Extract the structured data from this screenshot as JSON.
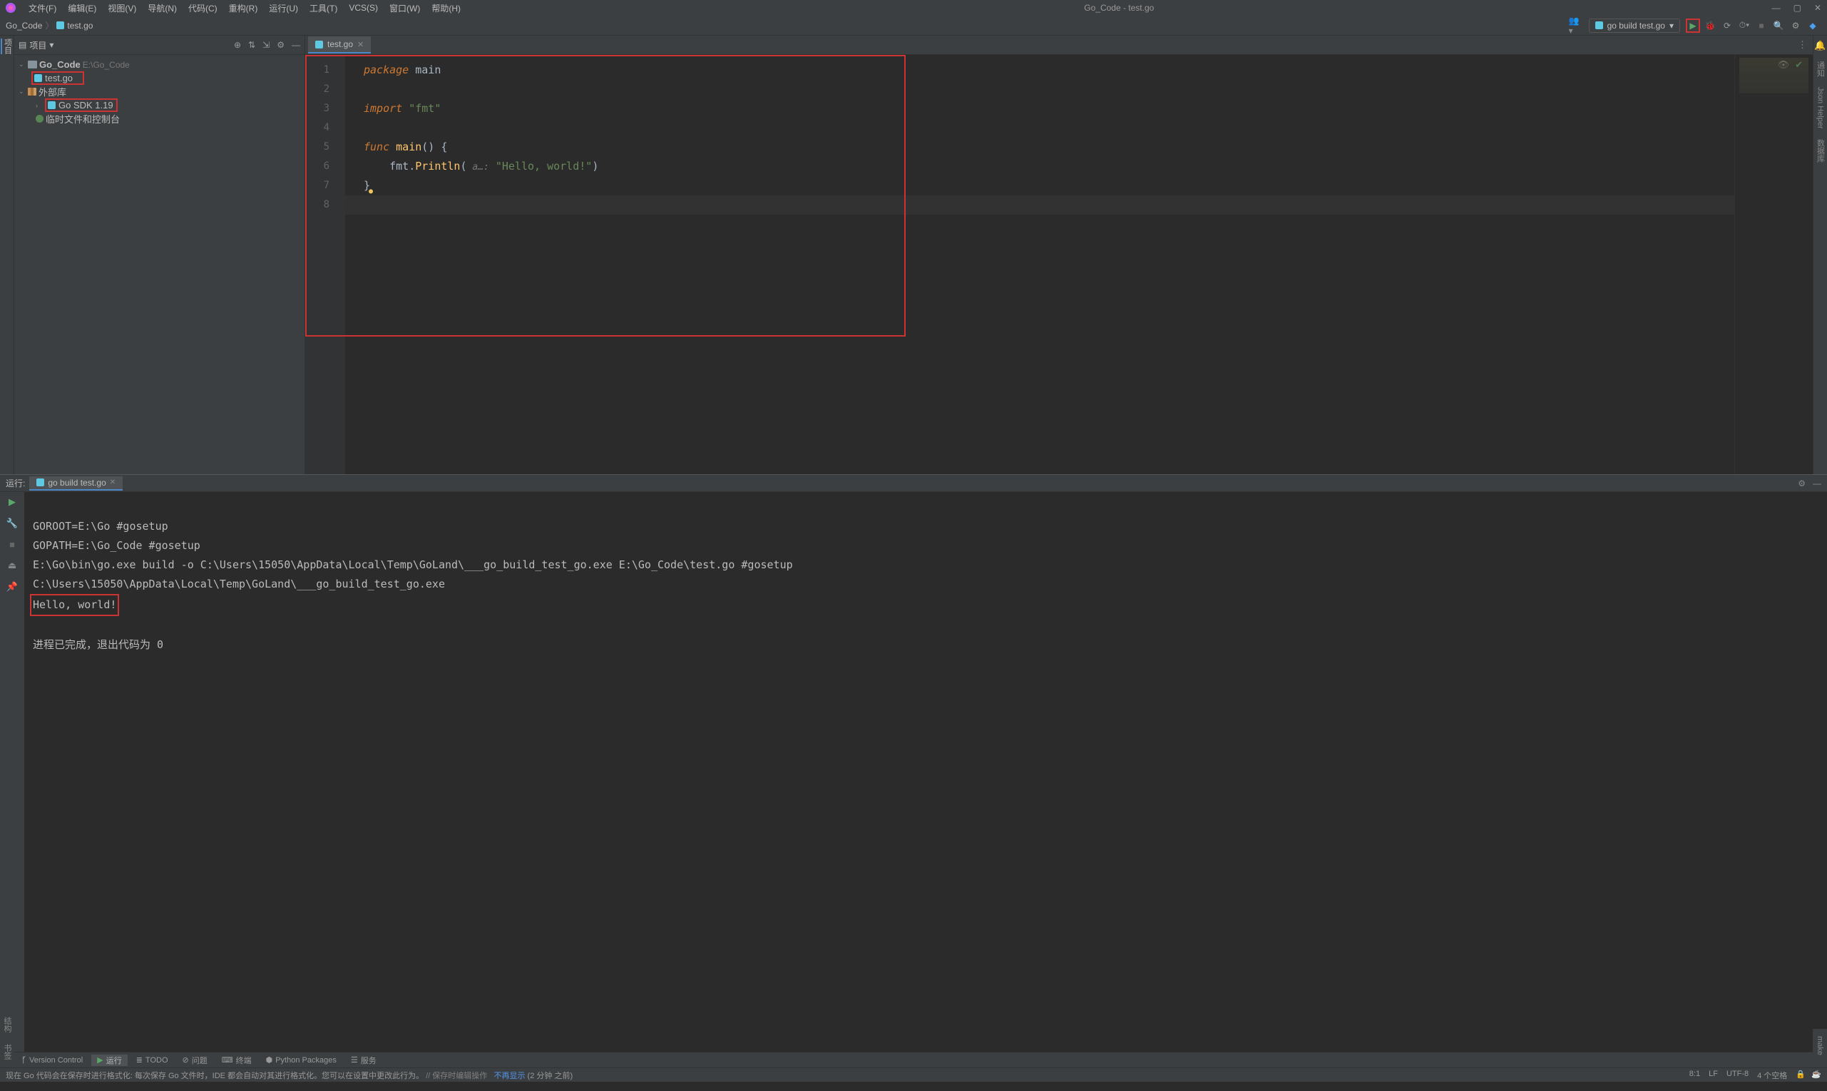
{
  "titlebar": {
    "menus": [
      "文件(F)",
      "编辑(E)",
      "视图(V)",
      "导航(N)",
      "代码(C)",
      "重构(R)",
      "运行(U)",
      "工具(T)",
      "VCS(S)",
      "窗口(W)",
      "帮助(H)"
    ],
    "title": "Go_Code - test.go"
  },
  "navbar": {
    "crumb_root": "Go_Code",
    "crumb_file": "test.go",
    "run_config": "go build test.go"
  },
  "sidebar": {
    "header_label": "项目",
    "root": {
      "name": "Go_Code",
      "path": "E:\\Go_Code"
    },
    "file": "test.go",
    "external_libs": "外部库",
    "go_sdk": "Go SDK 1.19",
    "scratches": "临时文件和控制台"
  },
  "editor": {
    "tab": "test.go",
    "code": {
      "l1_kw": "package",
      "l1_id": "main",
      "l3_kw": "import",
      "l3_str": "\"fmt\"",
      "l5_kw": "func",
      "l5_fn": "main",
      "l5_rest": "() {",
      "l6_pre": "    fmt.",
      "l6_fn": "Println",
      "l6_open": "(",
      "l6_hint": " a…:",
      "l6_str": " \"Hello, world!\"",
      "l6_close": ")",
      "l7": "}"
    },
    "line_numbers": [
      "1",
      "2",
      "3",
      "4",
      "5",
      "6",
      "7",
      "8"
    ]
  },
  "run": {
    "label": "运行:",
    "tab": "go build test.go",
    "output": {
      "l1": "GOROOT=E:\\Go #gosetup",
      "l2": "GOPATH=E:\\Go_Code #gosetup",
      "l3": "E:\\Go\\bin\\go.exe build -o C:\\Users\\15050\\AppData\\Local\\Temp\\GoLand\\___go_build_test_go.exe E:\\Go_Code\\test.go #gosetup",
      "l4": "C:\\Users\\15050\\AppData\\Local\\Temp\\GoLand\\___go_build_test_go.exe",
      "l5": "Hello, world!",
      "l7": "进程已完成，退出代码为 0"
    }
  },
  "bottom_tabs": {
    "vcs": "Version Control",
    "run": "运行",
    "todo": "TODO",
    "problems": "问题",
    "terminal": "终端",
    "python": "Python Packages",
    "services": "服务"
  },
  "statusbar": {
    "msg_pre": "现在 Go 代码会在保存时进行格式化: 每次保存 Go 文件时，IDE 都会自动对其进行格式化。您可以在设置中更改此行为。",
    "msg_action": " // 保存时编辑操作",
    "msg_link": "不再显示",
    "msg_time": "(2 分钟 之前)",
    "pos": "8:1",
    "le": "LF",
    "enc": "UTF-8",
    "indent": "4 个空格"
  },
  "left_rail": {
    "project": "项目",
    "structure": "结构",
    "bookmarks": "书签"
  },
  "right_rail": {
    "notif": "通知",
    "json": "Json Helper",
    "db": "数据库",
    "make": "make"
  }
}
